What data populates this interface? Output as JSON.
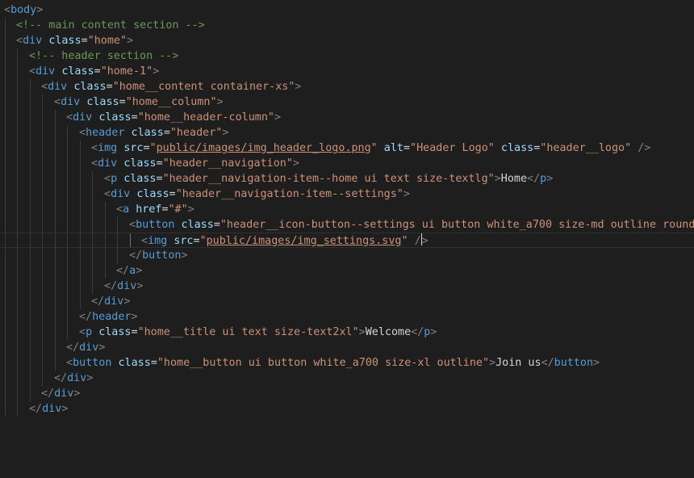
{
  "editor": {
    "background": "#1e1e1e",
    "colors": {
      "tag": "#569cd6",
      "attribute": "#9cdcfe",
      "string": "#ce9178",
      "comment": "#6a9955",
      "punctuation": "#808080",
      "text": "#d4d4d4"
    },
    "lines": [
      [
        "<",
        "body",
        ">"
      ],
      [
        "<!-- main content section -->"
      ],
      [
        "<",
        "div",
        " ",
        "class",
        "=",
        "\"home\"",
        ">"
      ],
      [
        "<!-- header section -->"
      ],
      [
        "<",
        "div",
        " ",
        "class",
        "=",
        "\"home-1\"",
        ">"
      ],
      [
        "<",
        "div",
        " ",
        "class",
        "=",
        "\"home__content container-xs\"",
        ">"
      ],
      [
        "<",
        "div",
        " ",
        "class",
        "=",
        "\"home__column\"",
        ">"
      ],
      [
        "<",
        "div",
        " ",
        "class",
        "=",
        "\"home__header-column\"",
        ">"
      ],
      [
        "<",
        "header",
        " ",
        "class",
        "=",
        "\"header\"",
        ">"
      ],
      [
        "<",
        "img",
        " ",
        "src",
        "=",
        "\"",
        "public/images/img_header_logo.png",
        "\"",
        " ",
        "alt",
        "=",
        "\"Header Logo\"",
        " ",
        "class",
        "=",
        "\"header__logo\"",
        " />"
      ],
      [
        "<",
        "div",
        " ",
        "class",
        "=",
        "\"header__navigation\"",
        ">"
      ],
      [
        "<",
        "p",
        " ",
        "class",
        "=",
        "\"header__navigation-item--home ui text size-textlg\"",
        ">",
        "Home",
        "</",
        "p",
        ">"
      ],
      [
        "<",
        "div",
        " ",
        "class",
        "=",
        "\"header__navigation-item--settings\"",
        ">"
      ],
      [
        "<",
        "a",
        " ",
        "href",
        "=",
        "\"#\"",
        ">"
      ],
      [
        "<",
        "button",
        " ",
        "class",
        "=",
        "\"header__icon-button--settings ui button white_a700 size-md outline round\"",
        ">"
      ],
      [
        "<",
        "img",
        " ",
        "src",
        "=",
        "\"",
        "public/images/img_settings.svg",
        "\"",
        " /",
        ">"
      ],
      [
        "</",
        "button",
        ">"
      ],
      [
        "</",
        "a",
        ">"
      ],
      [
        "</",
        "div",
        ">"
      ],
      [
        "</",
        "div",
        ">"
      ],
      [
        "</",
        "header",
        ">"
      ],
      [
        "<",
        "p",
        " ",
        "class",
        "=",
        "\"home__title ui text size-text2xl\"",
        ">",
        "Welcome",
        "</",
        "p",
        ">"
      ],
      [
        "</",
        "div",
        ">"
      ],
      [
        "<",
        "button",
        " ",
        "class",
        "=",
        "\"home__button ui button white_a700 size-xl outline\"",
        ">",
        "Join us",
        "</",
        "button",
        ">"
      ],
      [
        "</",
        "div",
        ">"
      ],
      [
        "</",
        "div",
        ">"
      ],
      [
        "</",
        "div",
        ">"
      ]
    ]
  }
}
